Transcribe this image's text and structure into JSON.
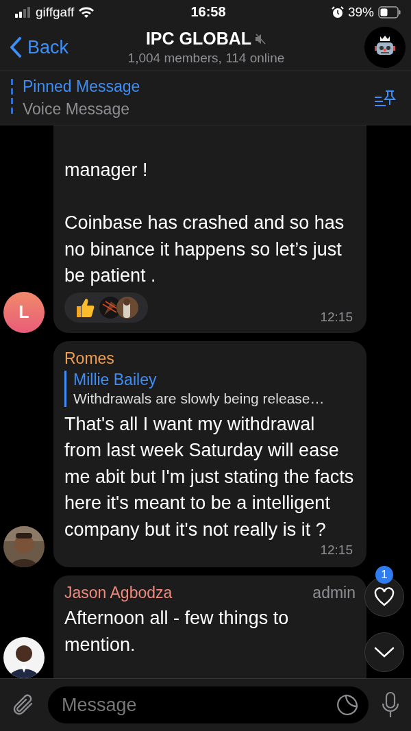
{
  "status_bar": {
    "carrier": "giffgaff",
    "time": "16:58",
    "battery": "39%"
  },
  "header": {
    "back": "Back",
    "title": "IPC GLOBAL",
    "muted": true,
    "subtitle": "1,004 members, 114 online"
  },
  "pinned": {
    "title": "Pinned Message",
    "text": "Voice Message"
  },
  "messages": [
    {
      "avatar": {
        "kind": "letter",
        "letter": "L"
      },
      "text": "manager !\n\nCoinbase has crashed and so has no binance it happens so let’s just be patient .",
      "reactions": true,
      "time": "12:15"
    },
    {
      "sender": "Romes",
      "color": "#f0a050",
      "reply": {
        "name": "Millie Bailey",
        "text": "Withdrawals are slowly being release…"
      },
      "text": "That's all I want my withdrawal from last week Saturday will ease me abit but I'm just stating the facts here it's meant to be a intelligent company but it's not really is it ?",
      "time": "12:15"
    },
    {
      "sender": "Jason Agbodza",
      "color": "#ef8a7c",
      "badge": "admin",
      "text": "Afternoon all - few things to mention."
    }
  ],
  "floating": {
    "reaction_count": "1"
  },
  "input": {
    "placeholder": "Message"
  }
}
